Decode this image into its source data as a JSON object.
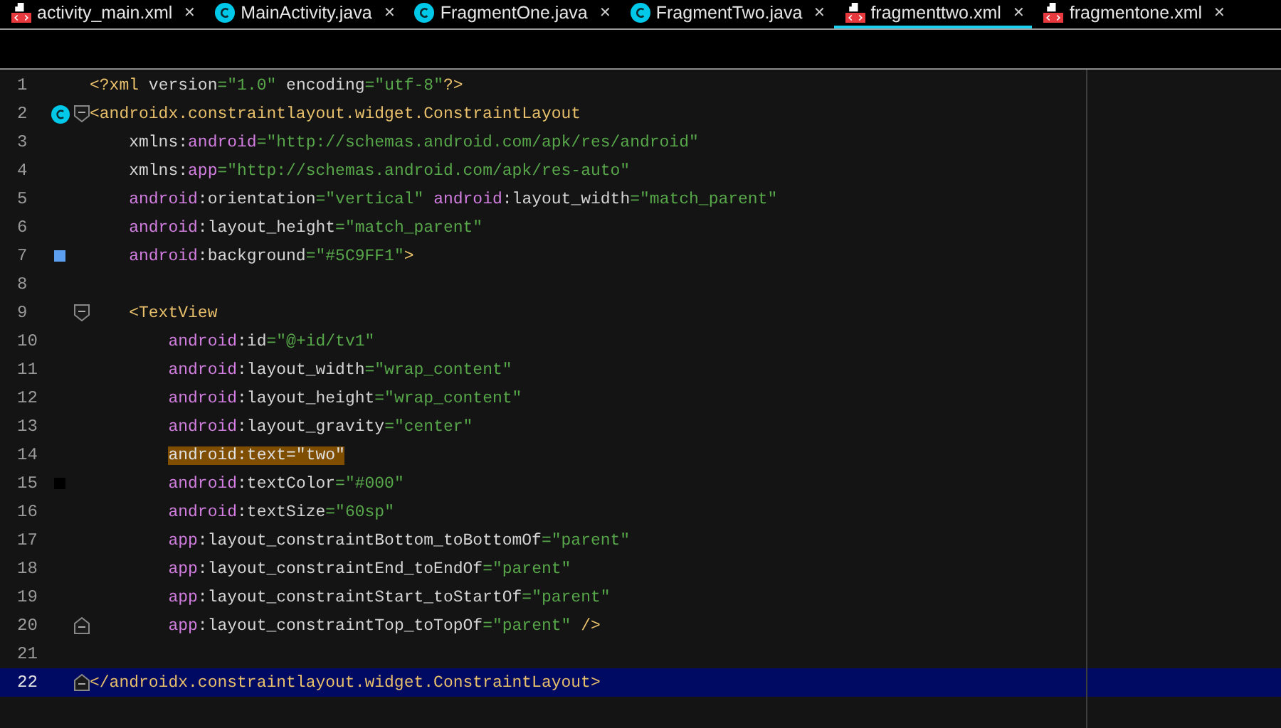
{
  "tabs": [
    {
      "label": "activity_main.xml",
      "kind": "xml",
      "selected": false
    },
    {
      "label": "MainActivity.java",
      "kind": "class",
      "selected": false
    },
    {
      "label": "FragmentOne.java",
      "kind": "class",
      "selected": false
    },
    {
      "label": "FragmentTwo.java",
      "kind": "class",
      "selected": false
    },
    {
      "label": "fragmenttwo.xml",
      "kind": "xml",
      "selected": true
    },
    {
      "label": "fragmentone.xml",
      "kind": "xml",
      "selected": false
    }
  ],
  "close_glyph": "✕",
  "lines": [
    {
      "number": "1",
      "tokens": [
        {
          "kind": "tag",
          "text": "<?xml "
        },
        {
          "kind": "attr",
          "text": "version"
        },
        {
          "kind": "str",
          "text": "=\"1.0\" "
        },
        {
          "kind": "attr",
          "text": "encoding"
        },
        {
          "kind": "str",
          "text": "=\"utf-8\""
        },
        {
          "kind": "tag",
          "text": "?>"
        }
      ]
    },
    {
      "number": "2",
      "class_icon": true,
      "fold_start": true,
      "tokens": [
        {
          "kind": "tag",
          "text": "<androidx.constraintlayout.widget.ConstraintLayout"
        }
      ]
    },
    {
      "number": "3",
      "tokens": [
        {
          "kind": "attr",
          "text": "    xmlns:"
        },
        {
          "kind": "ns",
          "text": "android"
        },
        {
          "kind": "str",
          "text": "=\"http://schemas.android.com/apk/res/android\""
        }
      ]
    },
    {
      "number": "4",
      "tokens": [
        {
          "kind": "attr",
          "text": "    xmlns:"
        },
        {
          "kind": "ns",
          "text": "app"
        },
        {
          "kind": "str",
          "text": "=\"http://schemas.android.com/apk/res-auto\""
        }
      ]
    },
    {
      "number": "5",
      "tokens": [
        {
          "kind": "ns",
          "text": "    android"
        },
        {
          "kind": "attr",
          "text": ":orientation"
        },
        {
          "kind": "str",
          "text": "=\"vertical\" "
        },
        {
          "kind": "ns",
          "text": "android"
        },
        {
          "kind": "attr",
          "text": ":layout_width"
        },
        {
          "kind": "str",
          "text": "=\"match_parent\""
        }
      ]
    },
    {
      "number": "6",
      "tokens": [
        {
          "kind": "ns",
          "text": "    android"
        },
        {
          "kind": "attr",
          "text": ":layout_height"
        },
        {
          "kind": "str",
          "text": "=\"match_parent\""
        }
      ]
    },
    {
      "number": "7",
      "color": "#5c9ff1",
      "tokens": [
        {
          "kind": "ns",
          "text": "    android"
        },
        {
          "kind": "attr",
          "text": ":background"
        },
        {
          "kind": "str",
          "text": "=\"#5C9FF1\""
        },
        {
          "kind": "tag",
          "text": ">"
        }
      ]
    },
    {
      "number": "8"
    },
    {
      "number": "9",
      "fold_start": true,
      "tokens": [
        {
          "kind": "tag",
          "text": "    <TextView"
        }
      ]
    },
    {
      "number": "10",
      "tokens": [
        {
          "kind": "ns",
          "text": "        android"
        },
        {
          "kind": "attr",
          "text": ":id"
        },
        {
          "kind": "str",
          "text": "=\"@+id/tv1\""
        }
      ]
    },
    {
      "number": "11",
      "tokens": [
        {
          "kind": "ns",
          "text": "        android"
        },
        {
          "kind": "attr",
          "text": ":layout_width"
        },
        {
          "kind": "str",
          "text": "=\"wrap_content\""
        }
      ]
    },
    {
      "number": "12",
      "tokens": [
        {
          "kind": "ns",
          "text": "        android"
        },
        {
          "kind": "attr",
          "text": ":layout_height"
        },
        {
          "kind": "str",
          "text": "=\"wrap_content\""
        }
      ]
    },
    {
      "number": "13",
      "tokens": [
        {
          "kind": "ns",
          "text": "        android"
        },
        {
          "kind": "attr",
          "text": ":layout_gravity"
        },
        {
          "kind": "str",
          "text": "=\"center\""
        }
      ]
    },
    {
      "number": "14",
      "highlighted": true,
      "tokens": [
        {
          "kind": "plain",
          "text": "        android:text=\"two\""
        }
      ]
    },
    {
      "number": "15",
      "color": "#000000",
      "tokens": [
        {
          "kind": "ns",
          "text": "        android"
        },
        {
          "kind": "attr",
          "text": ":textColor"
        },
        {
          "kind": "str",
          "text": "=\"#000\""
        }
      ]
    },
    {
      "number": "16",
      "tokens": [
        {
          "kind": "ns",
          "text": "        android"
        },
        {
          "kind": "attr",
          "text": ":textSize"
        },
        {
          "kind": "str",
          "text": "=\"60sp\""
        }
      ]
    },
    {
      "number": "17",
      "tokens": [
        {
          "kind": "ns",
          "text": "        app"
        },
        {
          "kind": "attr",
          "text": ":layout_constraintBottom_toBottomOf"
        },
        {
          "kind": "str",
          "text": "=\"parent\""
        }
      ]
    },
    {
      "number": "18",
      "tokens": [
        {
          "kind": "ns",
          "text": "        app"
        },
        {
          "kind": "attr",
          "text": ":layout_constraintEnd_toEndOf"
        },
        {
          "kind": "str",
          "text": "=\"parent\""
        }
      ]
    },
    {
      "number": "19",
      "tokens": [
        {
          "kind": "ns",
          "text": "        app"
        },
        {
          "kind": "attr",
          "text": ":layout_constraintStart_toStartOf"
        },
        {
          "kind": "str",
          "text": "=\"parent\""
        }
      ]
    },
    {
      "number": "20",
      "fold_end": true,
      "tokens": [
        {
          "kind": "ns",
          "text": "        app"
        },
        {
          "kind": "attr",
          "text": ":layout_constraintTop_toTopOf"
        },
        {
          "kind": "str",
          "text": "=\"parent\" "
        },
        {
          "kind": "tag",
          "text": "/>"
        }
      ]
    },
    {
      "number": "21"
    },
    {
      "number": "22",
      "current": true,
      "fold_end": true,
      "tokens": [
        {
          "kind": "tag",
          "text": "</androidx.constraintlayout.widget.ConstraintLayout>"
        }
      ]
    }
  ]
}
